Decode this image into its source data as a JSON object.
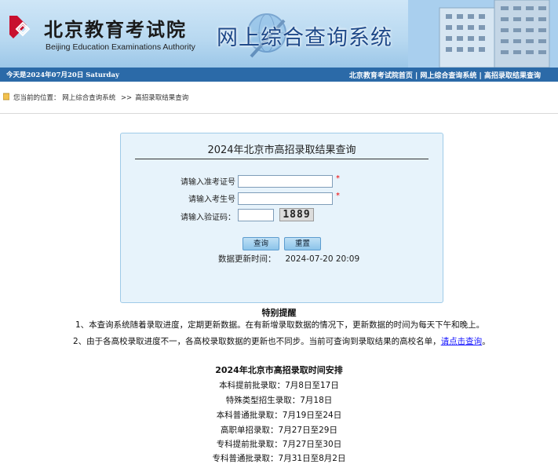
{
  "header": {
    "org_name_cn": "北京教育考试院",
    "org_name_en": "Beijing Education Examinations Authority",
    "system_title": "网上综合查询系统"
  },
  "topbar": {
    "date_text": "今天是2024年07月20日 Saturday",
    "links": [
      "北京教育考试院首页",
      "网上综合查询系统",
      "高招录取结果查询"
    ],
    "separator": " | "
  },
  "breadcrumb": {
    "prefix": "您当前的位置：",
    "items": [
      "网上综合查询系统",
      "高招录取结果查询"
    ],
    "separator": ">>"
  },
  "query_form": {
    "title": "2024年北京市高招录取结果查询",
    "exam_no_label": "请输入准考证号",
    "exam_no_value": "",
    "student_no_label": "请输入考生号",
    "student_no_value": "",
    "captcha_label": "请输入验证码：",
    "captcha_value": "",
    "captcha_image_text": "1889",
    "required_mark": "*",
    "query_button": "查询",
    "reset_button": "重置",
    "update_label": "数据更新时间：",
    "update_time": "2024-07-20 20:09"
  },
  "notice": {
    "title": "特别提醒",
    "line1": "1、本查询系统随着录取进度，定期更新数据。在有新增录取数据的情况下，更新数据的时间为每天下午和晚上。",
    "line2_text": "2、由于各高校录取进度不一，各高校录取数据的更新也不同步。当前可查询到录取结果的高校名单，",
    "line2_link": "请点击查询",
    "line2_end": "。"
  },
  "schedule": {
    "title": "2024年北京市高招录取时间安排",
    "rows": [
      "本科提前批录取：7月8日至17日",
      "特殊类型招生录取：7月18日",
      "本科普通批录取：7月19日至24日",
      "高职单招录取：7月27日至29日",
      "专科提前批录取：7月27日至30日",
      "专科普通批录取：7月31日至8月2日"
    ]
  },
  "colors": {
    "banner_blue": "#b7d8f0",
    "topbar_blue": "#2b6aa8",
    "title_blue": "#1f4a8a",
    "logo_red": "#c8102e",
    "link_blue": "#1a1aff",
    "required_red": "#e00000"
  }
}
